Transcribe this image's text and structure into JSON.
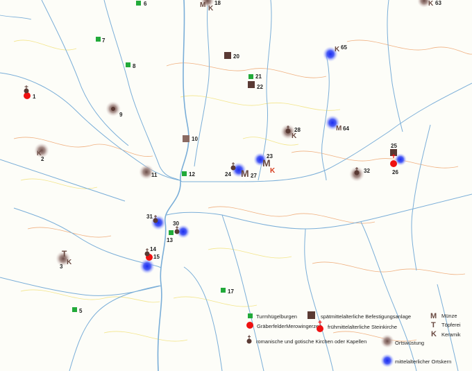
{
  "colors": {
    "turmhuegel": "#22aa3a",
    "befestigung": "#5a3a34",
    "graeber": "#ee1111",
    "kirche": "#5a3a34",
    "wuestung": "#8c6f6a",
    "ortskern": "#3344ee",
    "river": "#7aaed8",
    "contour_orange": "#f0b080",
    "contour_yellow": "#f3e58a"
  },
  "sites": [
    {
      "id": "6",
      "type": "turm"
    },
    {
      "id": "7",
      "type": "turm"
    },
    {
      "id": "8",
      "type": "turm"
    },
    {
      "id": "21",
      "type": "turm"
    },
    {
      "id": "12",
      "type": "turm"
    },
    {
      "id": "13",
      "type": "turm"
    },
    {
      "id": "17",
      "type": "turm"
    },
    {
      "id": "5",
      "type": "turm"
    },
    {
      "id": "20",
      "type": "befestigung"
    },
    {
      "id": "22",
      "type": "befestigung"
    },
    {
      "id": "10",
      "type": "befestigung"
    },
    {
      "id": "25",
      "type": "befestigung"
    },
    {
      "id": "1",
      "type": "graeber"
    },
    {
      "id": "15",
      "type": "graeber"
    },
    {
      "id": "26",
      "type": "graeber"
    },
    {
      "id": "24",
      "type": "kirche"
    },
    {
      "id": "14",
      "type": "kirche"
    },
    {
      "id": "9",
      "type": "wuestung"
    },
    {
      "id": "2",
      "type": "wuestung"
    },
    {
      "id": "11",
      "type": "wuestung"
    },
    {
      "id": "28",
      "type": "wuestung"
    },
    {
      "id": "32",
      "type": "wuestung"
    },
    {
      "id": "3",
      "type": "wuestung"
    },
    {
      "id": "18",
      "type": "wuestung"
    },
    {
      "id": "63",
      "type": "wuestung"
    },
    {
      "id": "65",
      "type": "ortskern"
    },
    {
      "id": "64",
      "type": "ortskern"
    },
    {
      "id": "23",
      "type": "ortskern"
    },
    {
      "id": "27",
      "type": "ortskern"
    },
    {
      "id": "31",
      "type": "ortskern"
    },
    {
      "id": "30",
      "type": "ortskern"
    }
  ],
  "legend": {
    "turm": "Turmhügelburgen",
    "befestigung": "spätmittelalterliche Befestigungsanlage",
    "graeber": "GräberfelderMerowingerzeit",
    "steinkirche": "frühmittelalterliche Steinkirche",
    "kirchen": "romanische und gotische Kirchen oder Kapellen",
    "wuestung": "Ortswüstung",
    "ortskern": "mittelalterlicher Ortskern",
    "muenze_letter": "M",
    "muenze": "Münze",
    "toepferei_letter": "T",
    "toepferei": "Töpferei",
    "keramik_letter": "K",
    "keramik": "Keramik"
  }
}
